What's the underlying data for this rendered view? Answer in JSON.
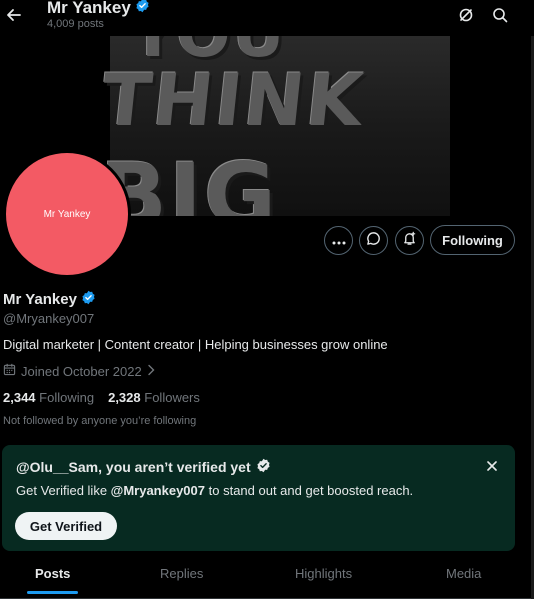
{
  "header": {
    "name": "Mr Yankey",
    "post_count": "4,009 posts",
    "icons": [
      "back-arrow-icon",
      "verified-badge-icon",
      "grok-icon",
      "search-icon"
    ]
  },
  "banner": {
    "lines": [
      "YOU",
      "THINK",
      "BIG"
    ]
  },
  "avatar": {
    "label": "Mr Yankey",
    "color": "#f35a64"
  },
  "actions": {
    "following_label": "Following",
    "icons": [
      "more-icon",
      "message-icon",
      "notify-icon"
    ]
  },
  "profile": {
    "name": "Mr Yankey",
    "handle": "@Mryankey007",
    "bio": "Digital marketer | Content creator | Helping businesses grow online",
    "joined": "Joined October 2022",
    "following_count": "2,344",
    "following_label": "Following",
    "followers_count": "2,328",
    "followers_label": "Followers",
    "not_followed": "Not followed by anyone you’re following"
  },
  "verify_card": {
    "title": "@Olu__Sam, you aren’t verified yet",
    "desc_prefix": "Get Verified like ",
    "desc_handle": "@Mryankey007",
    "desc_suffix": " to stand out and get boosted reach.",
    "button_label": "Get Verified",
    "bg_color": "#072a21"
  },
  "tabs": {
    "items": [
      "Posts",
      "Replies",
      "Highlights",
      "Media"
    ],
    "active": "Posts"
  },
  "colors": {
    "accent": "#1d9bf0",
    "verified": "#1d9bf0",
    "muted": "#71767b"
  }
}
